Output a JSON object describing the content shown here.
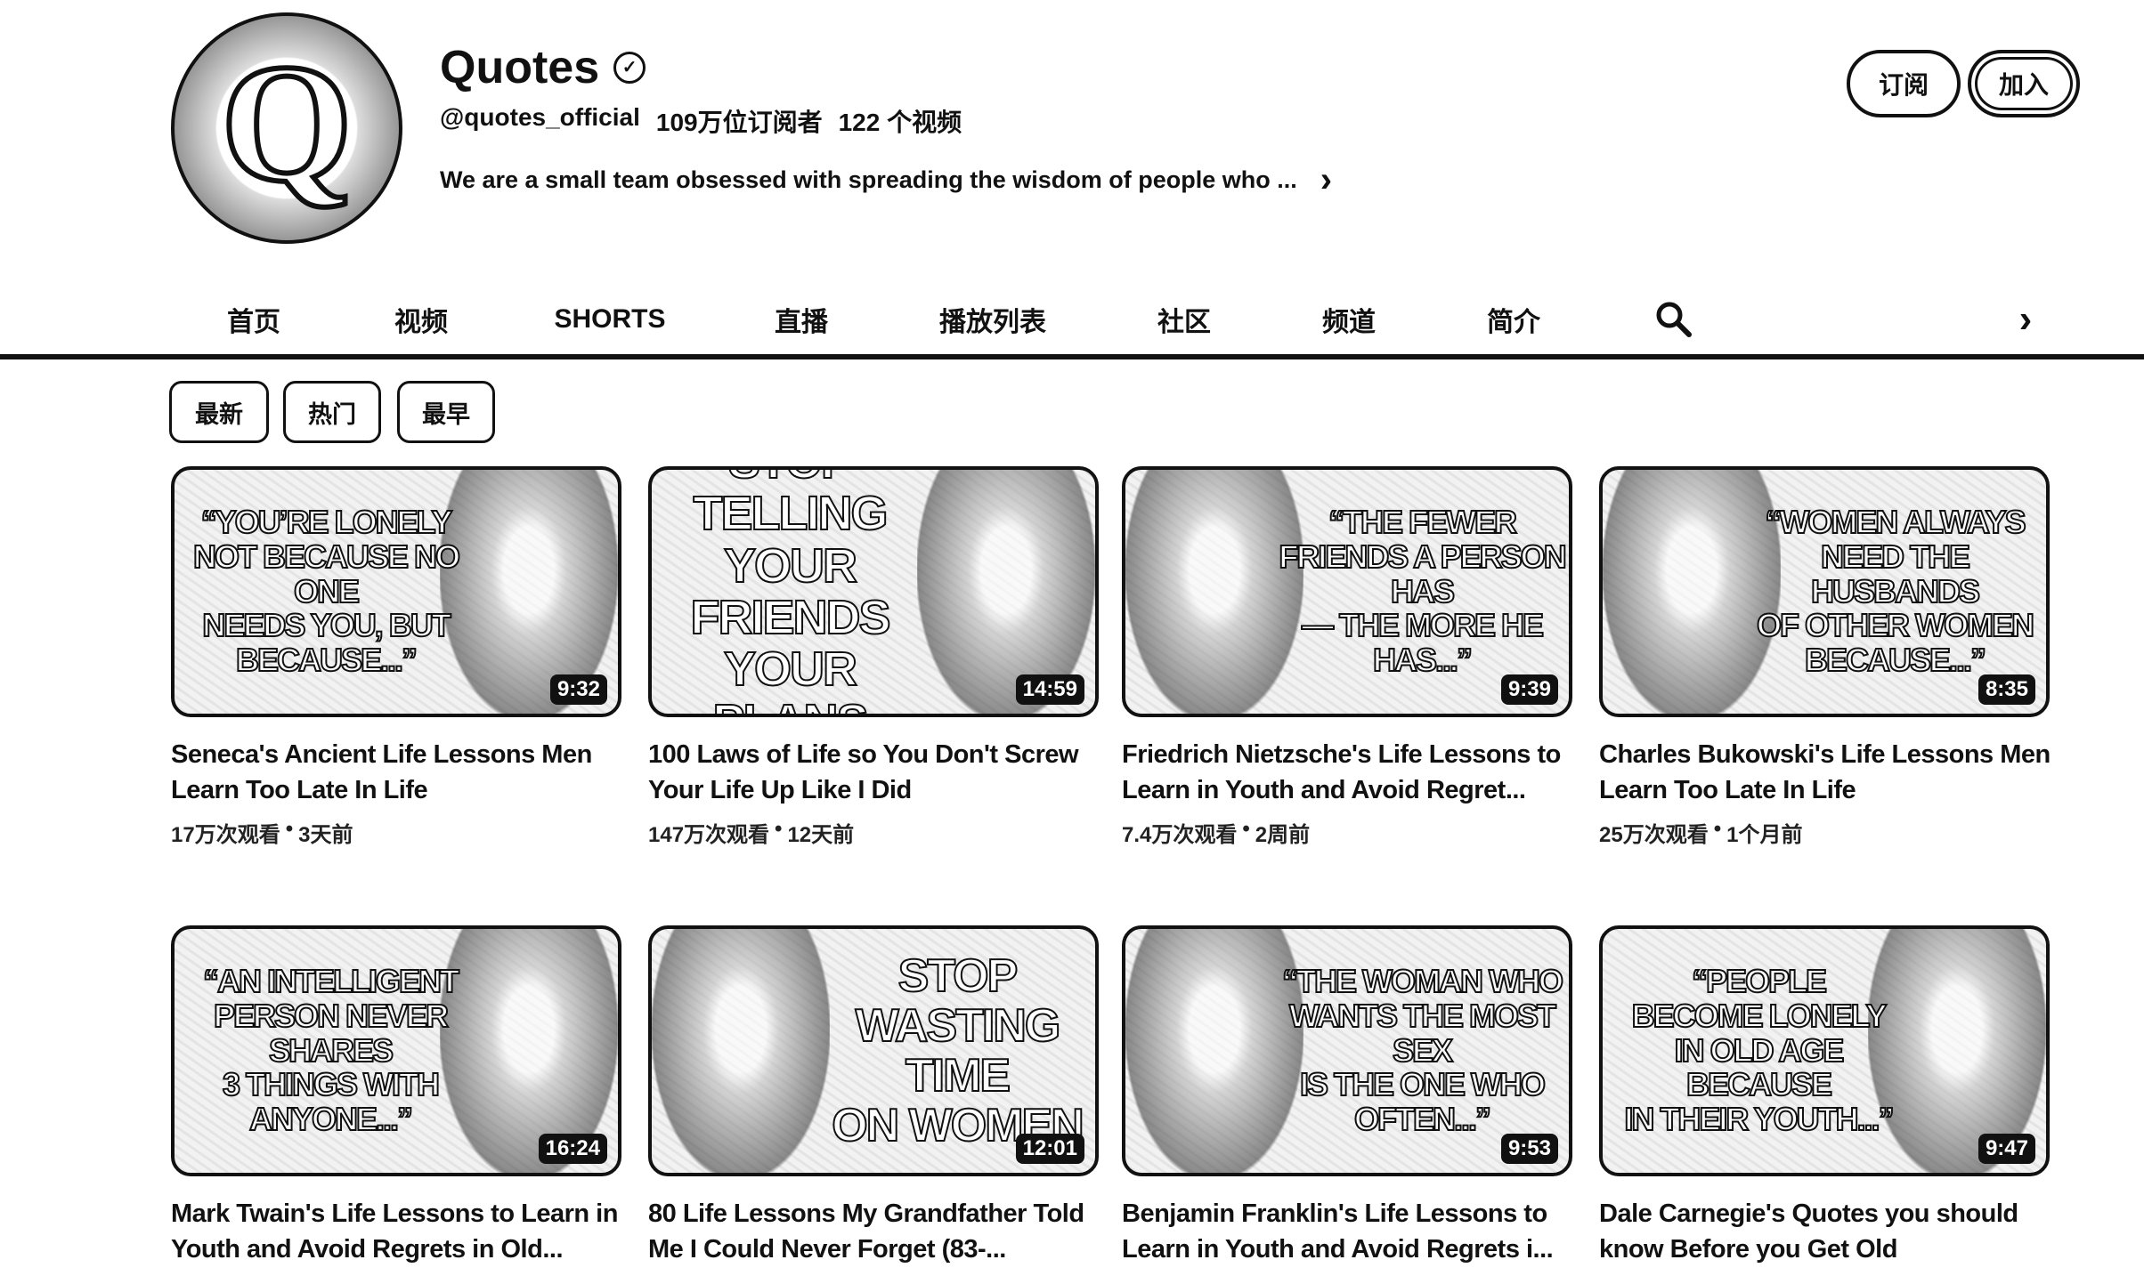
{
  "channel": {
    "avatar_letter": "Q",
    "name": "Quotes",
    "handle": "@quotes_official",
    "subscribers": "109万位订阅者",
    "video_count": "122 个视频",
    "description": "We are a small team obsessed with spreading the wisdom of people who ..."
  },
  "actions": {
    "subscribe_label": "订阅",
    "join_label": "加入"
  },
  "tabs": [
    {
      "label": "首页"
    },
    {
      "label": "视频"
    },
    {
      "label": "SHORTS"
    },
    {
      "label": "直播"
    },
    {
      "label": "播放列表"
    },
    {
      "label": "社区"
    },
    {
      "label": "频道"
    },
    {
      "label": "简介"
    }
  ],
  "active_tab": "视频",
  "chips": [
    {
      "label": "最新"
    },
    {
      "label": "热门"
    },
    {
      "label": "最早"
    }
  ],
  "videos": [
    {
      "thumb_text": "“YOU’RE LONELY\nNOT BECAUSE NO ONE\nNEEDS YOU, BUT\nBECAUSE...”",
      "duration": "9:32",
      "title": "Seneca's Ancient Life Lessons Men Learn Too Late In Life",
      "views": "17万次观看",
      "age": "3天前"
    },
    {
      "thumb_text": "STOP TELLING\nYOUR FRIENDS\nYOUR PLANS",
      "duration": "14:59",
      "title": "100 Laws of Life so You Don't Screw Your Life Up Like I Did",
      "views": "147万次观看",
      "age": "12天前"
    },
    {
      "thumb_text": "“THE FEWER\nFRIENDS A PERSON HAS\n— THE MORE HE\nHAS...”",
      "duration": "9:39",
      "title": "Friedrich Nietzsche's Life Lessons to Learn in Youth and Avoid Regret...",
      "views": "7.4万次观看",
      "age": "2周前"
    },
    {
      "thumb_text": "“WOMEN ALWAYS\nNEED THE HUSBANDS\nOF OTHER WOMEN\nBECAUSE...”",
      "duration": "8:35",
      "title": "Charles Bukowski's Life Lessons Men Learn Too Late In Life",
      "views": "25万次观看",
      "age": "1个月前"
    },
    {
      "thumb_text": "“AN INTELLIGENT\nPERSON NEVER SHARES\n3 THINGS WITH\nANYONE...”",
      "duration": "16:24",
      "title": "Mark Twain's Life Lessons to Learn in Youth and Avoid Regrets in Old...",
      "views": "",
      "age": ""
    },
    {
      "thumb_text": "STOP\nWASTING TIME\nON WOMEN",
      "duration": "12:01",
      "title": "80 Life Lessons My Grandfather Told Me I Could Never Forget (83-...",
      "views": "",
      "age": ""
    },
    {
      "thumb_text": "“THE WOMAN WHO\nWANTS THE MOST SEX\nIS THE ONE WHO\nOFTEN...”",
      "duration": "9:53",
      "title": "Benjamin Franklin's Life Lessons to Learn in Youth and Avoid Regrets i...",
      "views": "",
      "age": ""
    },
    {
      "thumb_text": "“PEOPLE\nBECOME LONELY\nIN OLD AGE BECAUSE\nIN THEIR YOUTH...”",
      "duration": "9:47",
      "title": "Dale Carnegie's Quotes you should know Before you Get Old",
      "views": "",
      "age": ""
    }
  ]
}
